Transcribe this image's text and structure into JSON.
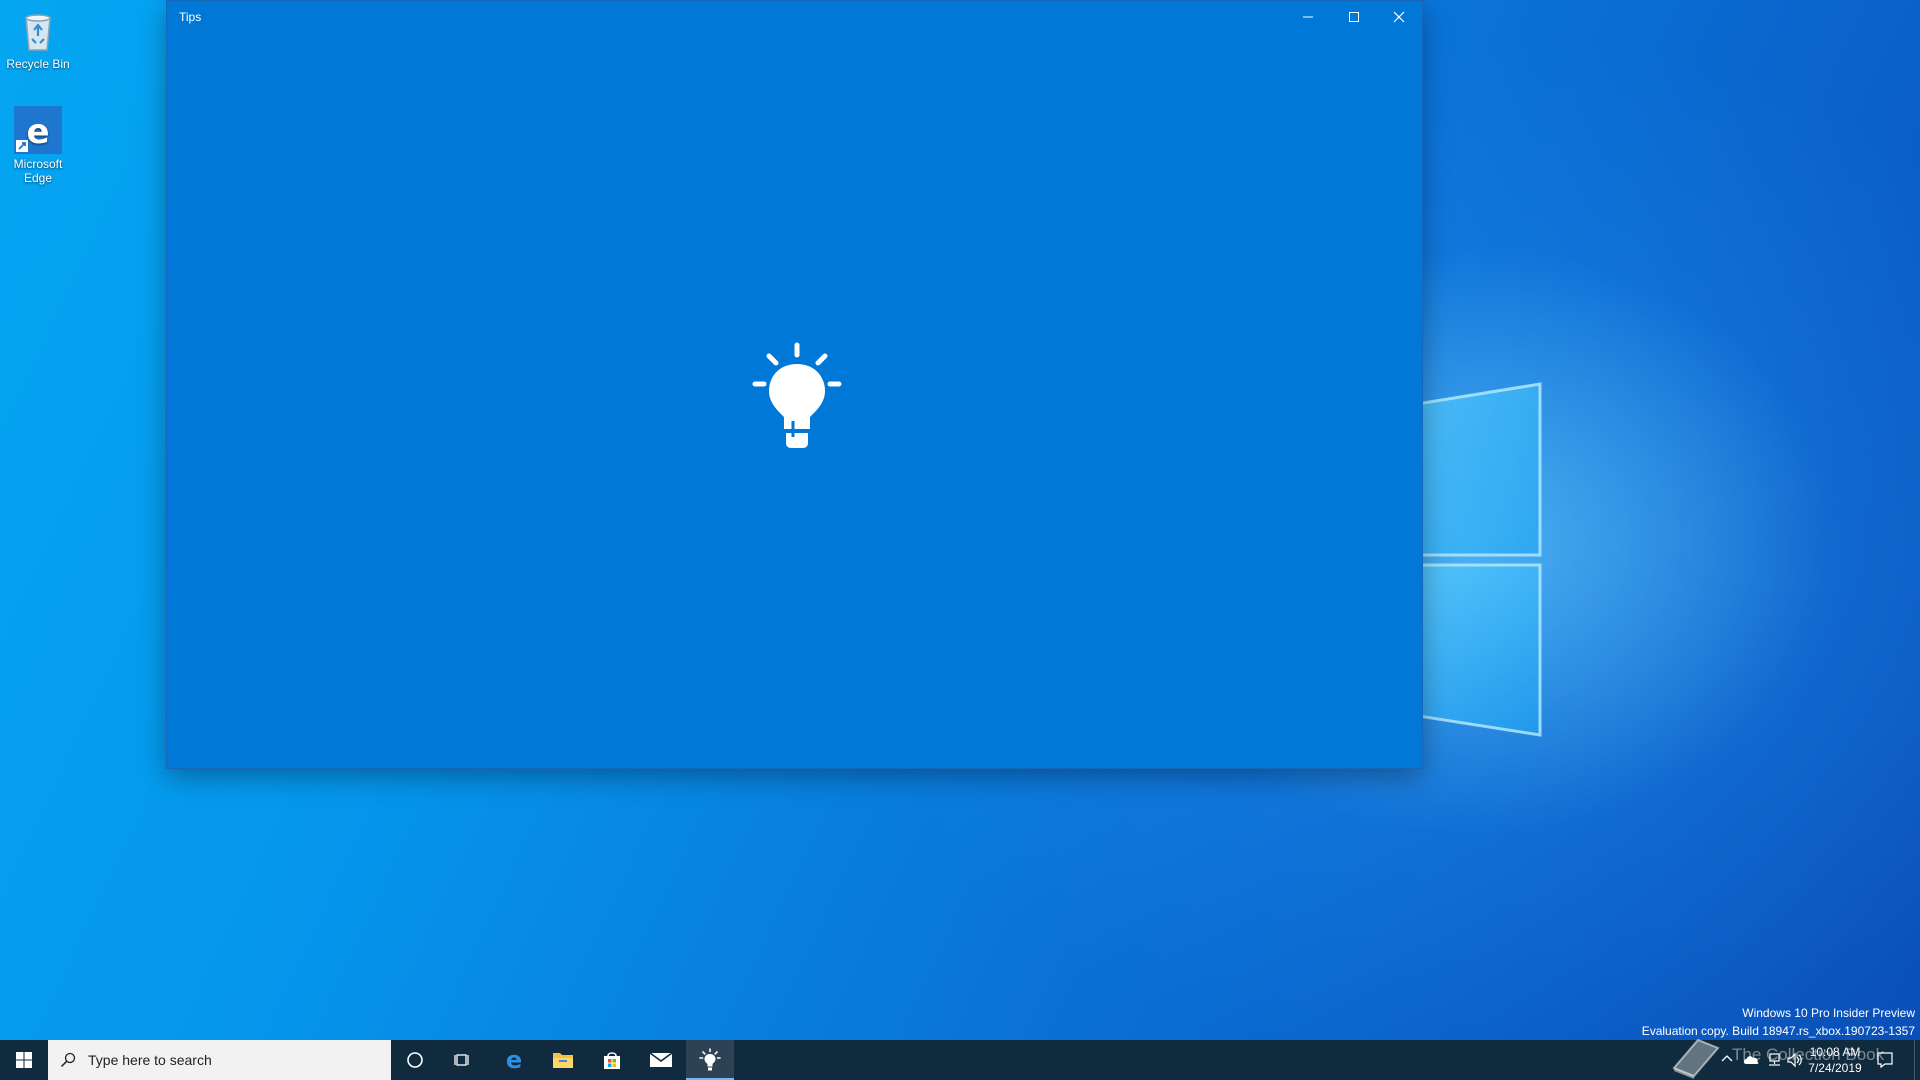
{
  "desktop": {
    "icons": [
      {
        "label": "Recycle Bin",
        "icon": "recycle-bin-icon"
      },
      {
        "label": "Microsoft Edge",
        "icon": "edge-icon"
      }
    ],
    "watermark": {
      "line1": "Windows 10 Pro Insider Preview",
      "line2": "Evaluation copy. Build 18947.rs_xbox.190723-1357"
    },
    "overlay_text": "The Collection Book"
  },
  "window": {
    "title": "Tips",
    "background_color": "#0078d7",
    "splash_icon": "lightbulb-icon",
    "controls": {
      "minimize": "minimize-icon",
      "maximize": "maximize-icon",
      "close": "close-icon"
    }
  },
  "taskbar": {
    "search": {
      "placeholder": "Type here to search"
    },
    "pinned": [
      "cortana-icon",
      "task-view-icon",
      "edge-icon",
      "file-explorer-icon",
      "store-icon",
      "mail-icon",
      "tips-icon"
    ],
    "active_app": "Tips",
    "clock": {
      "time": "10:08 AM",
      "date": "7/24/2019"
    }
  },
  "colors": {
    "taskbar": "#102a3e",
    "accent": "#0078d7",
    "search_bg": "#f2f2f2"
  }
}
